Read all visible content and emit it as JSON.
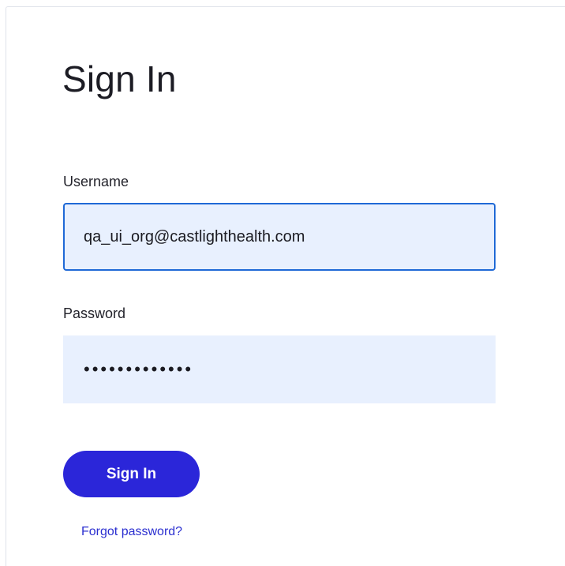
{
  "form": {
    "title": "Sign In",
    "username": {
      "label": "Username",
      "value": "qa_ui_org@castlighthealth.com"
    },
    "password": {
      "label": "Password",
      "value": "•••••••••••••"
    },
    "submit_label": "Sign In",
    "forgot_label": "Forgot password?"
  },
  "colors": {
    "primary_button": "#2b26d9",
    "input_background": "#e8f0fe",
    "focus_border": "#1f69d6",
    "link": "#2b2fd0"
  }
}
